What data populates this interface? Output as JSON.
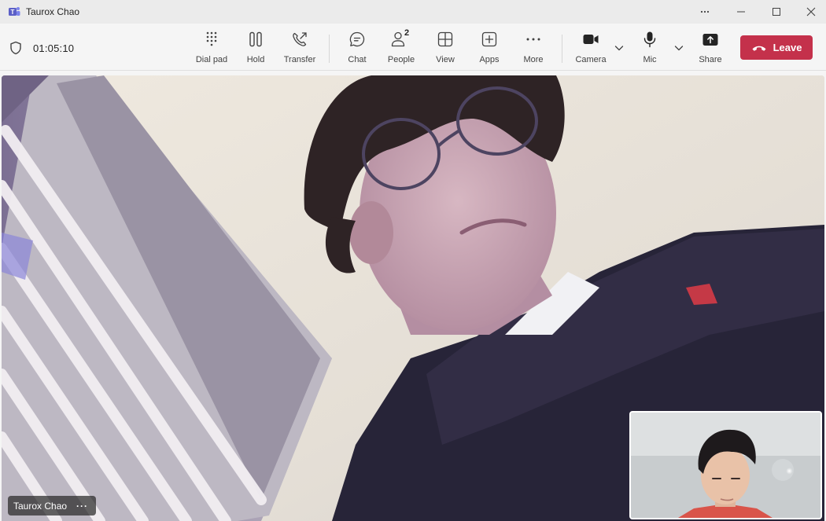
{
  "window": {
    "title": "Taurox Chao"
  },
  "call": {
    "duration": "01:05:10"
  },
  "toolbar": {
    "dial_pad": "Dial pad",
    "hold": "Hold",
    "transfer": "Transfer",
    "chat": "Chat",
    "people": "People",
    "people_count": "2",
    "view": "View",
    "apps": "Apps",
    "more": "More",
    "camera": "Camera",
    "mic": "Mic",
    "share": "Share",
    "leave": "Leave"
  },
  "stage": {
    "participant_name": "Taurox Chao",
    "options_glyph": "···"
  },
  "colors": {
    "leave_button": "#c4314b",
    "accent": "#5b5fc7"
  }
}
